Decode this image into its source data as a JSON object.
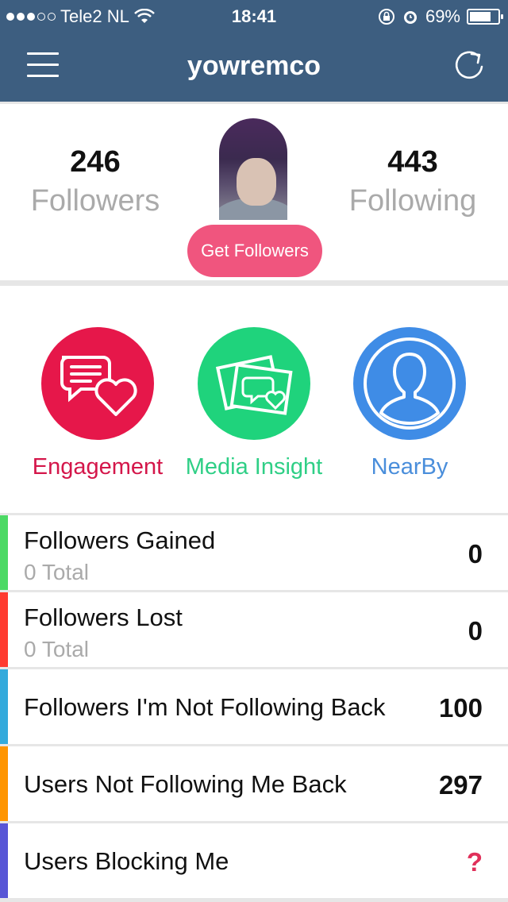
{
  "status_bar": {
    "carrier": "Tele2 NL",
    "time": "18:41",
    "battery": "69%"
  },
  "nav": {
    "title": "yowremco"
  },
  "profile": {
    "followers_count": "246",
    "followers_label": "Followers",
    "following_count": "443",
    "following_label": "Following",
    "get_followers_label": "Get Followers"
  },
  "features": [
    {
      "label": "Engagement"
    },
    {
      "label": "Media Insight"
    },
    {
      "label": "NearBy"
    }
  ],
  "stats": [
    {
      "title": "Followers Gained",
      "sub": "0 Total",
      "value": "0",
      "color": "#4cd964"
    },
    {
      "title": "Followers Lost",
      "sub": "0 Total",
      "value": "0",
      "color": "#ff3b30"
    },
    {
      "title": "Followers I'm Not Following Back",
      "value": "100",
      "color": "#34aadc"
    },
    {
      "title": "Users Not Following Me Back",
      "value": "297",
      "color": "#ff9500"
    },
    {
      "title": "Users Blocking Me",
      "value": "?",
      "color": "#5856d6"
    }
  ],
  "colors": {
    "header": "#3d5e80",
    "accent_pink": "#f0557e",
    "engagement": "#e6174a",
    "media_insight": "#1fd37c",
    "nearby": "#3f8ce6"
  }
}
